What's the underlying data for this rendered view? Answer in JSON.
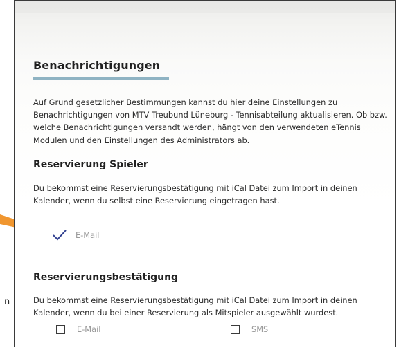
{
  "section": {
    "title": "Benachrichtigungen",
    "intro": "Auf Grund gesetzlicher Bestimmungen kannst du hier deine Einstellungen zu Benachrichtigungen von MTV Treubund Lüneburg - Tennisabteilung aktualisieren. Ob bzw. welche Benachrichtigungen versandt werden, hängt von den verwendeten eTennis Modulen und den Einstellungen des Administrators ab."
  },
  "reservierung_spieler": {
    "title": "Reservierung Spieler",
    "description": "Du bekommst eine Reservierungsbestätigung mit iCal Datei zum Import in deinen Kalender, wenn du selbst eine Reservierung eingetragen hast.",
    "options": [
      {
        "label": "E-Mail",
        "checked": true
      }
    ]
  },
  "reservierungsbestaetigung": {
    "title": "Reservierungsbestätigung",
    "description": "Du bekommst eine Reservierungsbestätigung mit iCal Datei zum Import in deinen Kalender, wenn du bei einer Reservierung als Mitspieler ausgewählt wurdest.",
    "options": [
      {
        "label": "E-Mail",
        "checked": false
      },
      {
        "label": "SMS",
        "checked": false
      }
    ]
  },
  "outside_fragment": "n",
  "colors": {
    "accent_underline": "#8fb3c3",
    "annotation_arrow": "#f0962f",
    "checkmark": "#2f3f8f",
    "option_text": "#9a9a9a"
  }
}
